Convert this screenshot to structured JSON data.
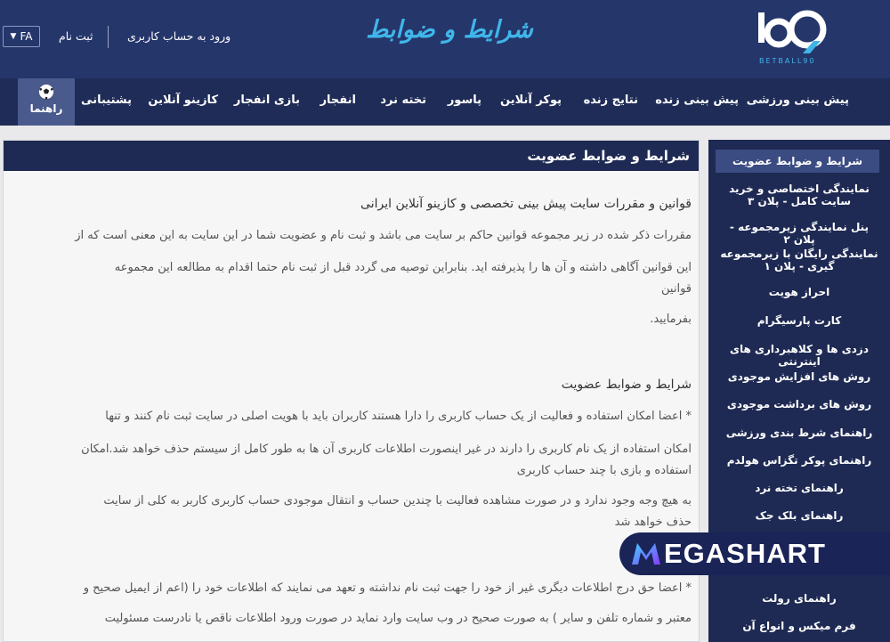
{
  "header": {
    "lang": "FA",
    "register": "ثبت نام",
    "login": "ورود به حساب کاربری",
    "page_heading": "شرایط و ضوابط",
    "logo_text": "BETBALL90"
  },
  "nav": {
    "items": [
      "پیش بینی ورزشی",
      "پیش بینی زنده",
      "نتایج زنده",
      "پوکر آنلاین",
      "پاسور",
      "تخته نرد",
      "انفجار",
      "بازی انفجار",
      "کازینو آنلاین",
      "پشتیبانی"
    ],
    "help": "راهنما"
  },
  "main": {
    "title": "شرایط و ضوابط عضویت",
    "paragraphs": [
      "قوانین و مقررات سایت پیش بینی تخصصی و کازینو آنلاین ایرانی",
      "مقررات ذکر شده در زیر مجموعه قوانین حاکم بر سایت می باشد و ثبت نام و عضویت شما در این سایت به این معنی است که از",
      "این قوانین آگاهی داشته و آن ها را پذیرفته اید. بنابراین توصیه می گردد قبل از ثبت نام حتما اقدام به مطالعه این مجموعه",
      "قوانین",
      "بفرمایید.",
      "شرایط و ضوابط عضویت",
      "* اعضا امکان استفاده و فعالیت از یک حساب کاربری را دارا هستند کاربران باید با هویت اصلی در سایت ثبت نام کنند و تنها",
      "امکان استفاده از یک نام کاربری را دارند در غیر اینصورت اطلاعات کاربری آن ها به طور کامل از سیستم حذف خواهد شد.امکان",
      "استفاده و بازی با چند حساب کاربری",
      "به هیچ وجه وجود ندارد و در صورت مشاهده فعالیت با چندین حساب و انتقال موجودی حساب کاربری کاربر به کلی از سایت",
      "حذف خواهد شد",
      "* اعضا حق درج اطلاعات دیگری غیر از خود را جهت ثبت نام نداشته و تعهد می نمایند که اطلاعات خود را (اعم از ایمیل صحیح و",
      "معتبر و شماره تلفن و سایر ) به صورت صحیح در وب سایت وارد نماید در صورت ورود اطلاعات ناقص یا نادرست مسئولیت"
    ]
  },
  "sidebar": {
    "items": [
      "شرایط و ضوابط عضویت",
      "نمایندگی اختصاصی و خرید سایت کامل - پلان ۳",
      "پنل نمایندگی زیرمجموعه - پلان ۲",
      "نمایندگی رایگان با زیرمجموعه گیری - پلان ۱",
      "احراز هویت",
      "کارت پارسیگرام",
      "دزدی ها و کلاهبرداری های اینترنتی",
      "روش های افزایش موجودی",
      "روش های برداشت موجودی",
      "راهنمای شرط بندی ورزشی",
      "راهنمای پوکر تگزاس هولدم",
      "راهنمای تخته نرد",
      "راهنمای بلک جک",
      "راهنمای رولت",
      "فرم میکس و انواع آن"
    ]
  },
  "watermark": {
    "text": "EGASHART"
  },
  "colors": {
    "header": "#25366b",
    "nav": "#1f2c57",
    "accent": "#3fb6ea",
    "panel": "#1e2a53"
  }
}
